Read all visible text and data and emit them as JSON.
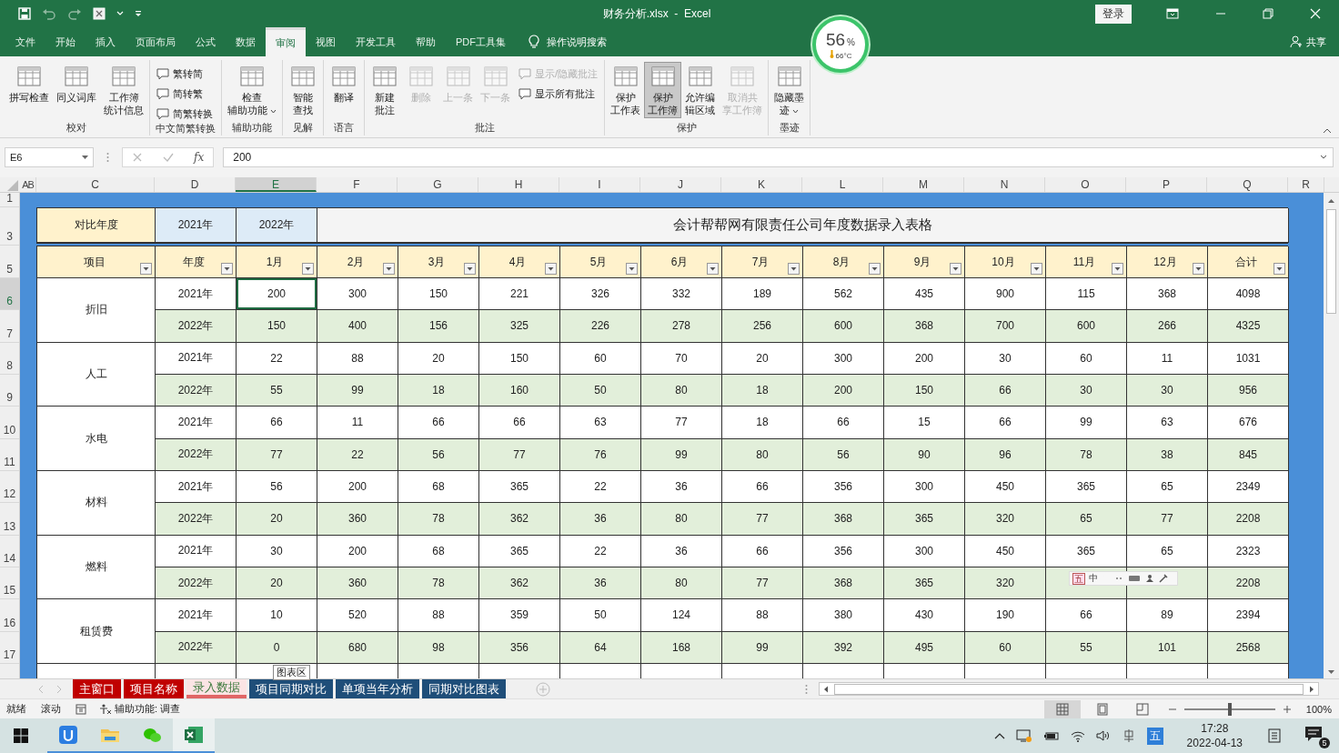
{
  "title_bar": {
    "title": "财务分析.xlsx  -  Excel",
    "sign_in": "登录"
  },
  "ribbon_tabs": [
    {
      "label": "文件",
      "selected": false
    },
    {
      "label": "开始",
      "selected": false
    },
    {
      "label": "插入",
      "selected": false
    },
    {
      "label": "页面布局",
      "selected": false
    },
    {
      "label": "公式",
      "selected": false
    },
    {
      "label": "数据",
      "selected": false
    },
    {
      "label": "审阅",
      "selected": true
    },
    {
      "label": "视图",
      "selected": false
    },
    {
      "label": "开发工具",
      "selected": false
    },
    {
      "label": "帮助",
      "selected": false
    },
    {
      "label": "PDF工具集",
      "selected": false
    }
  ],
  "search": "操作说明搜索",
  "share": "共享",
  "ribbon_groups": [
    {
      "label": "校对",
      "buttons": [
        {
          "label": "拼写检查",
          "kind": "large",
          "disabled": false,
          "selected": false
        },
        {
          "label": "同义词库",
          "kind": "large",
          "disabled": false,
          "selected": false
        },
        {
          "label": [
            "工作簿",
            "统计信息"
          ],
          "kind": "large",
          "disabled": false,
          "selected": false
        }
      ]
    },
    {
      "label": "中文简繁转换",
      "buttons": [
        {
          "label": "繁转简",
          "kind": "small",
          "disabled": false,
          "selected": false
        },
        {
          "label": "简转繁",
          "kind": "small",
          "disabled": false,
          "selected": false
        },
        {
          "label": "简繁转换",
          "kind": "small",
          "disabled": false,
          "selected": false
        }
      ]
    },
    {
      "label": "辅助功能",
      "buttons": [
        {
          "label": [
            "检查",
            "辅助功能"
          ],
          "kind": "large-menu",
          "disabled": false,
          "selected": false
        }
      ]
    },
    {
      "label": "见解",
      "buttons": [
        {
          "label": [
            "智能",
            "查找"
          ],
          "kind": "large",
          "disabled": false,
          "selected": false
        }
      ]
    },
    {
      "label": "语言",
      "buttons": [
        {
          "label": "翻译",
          "kind": "large",
          "disabled": false,
          "selected": false
        }
      ]
    },
    {
      "label": "批注",
      "buttons": [
        {
          "label": [
            "新建",
            "批注"
          ],
          "kind": "large",
          "disabled": false,
          "selected": false
        },
        {
          "label": "删除",
          "kind": "large",
          "disabled": true,
          "selected": false
        },
        {
          "label": "上一条",
          "kind": "large",
          "disabled": true,
          "selected": false
        },
        {
          "label": "下一条",
          "kind": "large",
          "disabled": true,
          "selected": false
        },
        {
          "label": "显示/隐藏批注",
          "kind": "small",
          "disabled": true,
          "selected": false
        },
        {
          "label": "显示所有批注",
          "kind": "small",
          "disabled": false,
          "selected": false
        }
      ]
    },
    {
      "label": "保护",
      "buttons": [
        {
          "label": [
            "保护",
            "工作表"
          ],
          "kind": "large",
          "disabled": false,
          "selected": false
        },
        {
          "label": [
            "保护",
            "工作簿"
          ],
          "kind": "large",
          "disabled": false,
          "selected": true
        },
        {
          "label": [
            "允许编",
            "辑区域"
          ],
          "kind": "large",
          "disabled": false,
          "selected": false
        },
        {
          "label": [
            "取消共",
            "享工作簿"
          ],
          "kind": "large",
          "disabled": true,
          "selected": false
        }
      ]
    },
    {
      "label": "墨迹",
      "buttons": [
        {
          "label": [
            "隐藏墨",
            "迹"
          ],
          "kind": "large-menu",
          "disabled": false,
          "selected": false
        }
      ]
    }
  ],
  "formula_bar": {
    "name_box": "E6",
    "fx": "fx",
    "value": "200"
  },
  "column_headers": [
    {
      "label": "AB",
      "selected": false
    },
    {
      "label": "C",
      "selected": false
    },
    {
      "label": "D",
      "selected": false
    },
    {
      "label": "E",
      "selected": true
    },
    {
      "label": "F",
      "selected": false
    },
    {
      "label": "G",
      "selected": false
    },
    {
      "label": "H",
      "selected": false
    },
    {
      "label": "I",
      "selected": false
    },
    {
      "label": "J",
      "selected": false
    },
    {
      "label": "K",
      "selected": false
    },
    {
      "label": "L",
      "selected": false
    },
    {
      "label": "M",
      "selected": false
    },
    {
      "label": "N",
      "selected": false
    },
    {
      "label": "O",
      "selected": false
    },
    {
      "label": "P",
      "selected": false
    },
    {
      "label": "Q",
      "selected": false
    },
    {
      "label": "R",
      "selected": false
    }
  ],
  "row_headers": [
    {
      "label": "1",
      "selected": false
    },
    {
      "label": "3",
      "selected": false
    },
    {
      "label": "5",
      "selected": false
    },
    {
      "label": "6",
      "selected": true
    },
    {
      "label": "7",
      "selected": false
    },
    {
      "label": "8",
      "selected": false
    },
    {
      "label": "9",
      "selected": false
    },
    {
      "label": "10",
      "selected": false
    },
    {
      "label": "11",
      "selected": false
    },
    {
      "label": "12",
      "selected": false
    },
    {
      "label": "13",
      "selected": false
    },
    {
      "label": "14",
      "selected": false
    },
    {
      "label": "15",
      "selected": false
    },
    {
      "label": "16",
      "selected": false
    },
    {
      "label": "17",
      "selected": false
    }
  ],
  "sheet": {
    "compare_label": "对比年度",
    "years": [
      "2021年",
      "2022年"
    ],
    "title": "会计帮帮网有限责任公司年度数据录入表格",
    "columns": [
      "项目",
      "年度",
      "1月",
      "2月",
      "3月",
      "4月",
      "5月",
      "6月",
      "7月",
      "8月",
      "9月",
      "10月",
      "11月",
      "12月",
      "合计"
    ],
    "groups": [
      {
        "item": "折旧",
        "rows": [
          {
            "year": "2021年",
            "values": [
              "200",
              "300",
              "150",
              "221",
              "326",
              "332",
              "189",
              "562",
              "435",
              "900",
              "115",
              "368"
            ],
            "total": "4098"
          },
          {
            "year": "2022年",
            "values": [
              "150",
              "400",
              "156",
              "325",
              "226",
              "278",
              "256",
              "600",
              "368",
              "700",
              "600",
              "266"
            ],
            "total": "4325"
          }
        ]
      },
      {
        "item": "人工",
        "rows": [
          {
            "year": "2021年",
            "values": [
              "22",
              "88",
              "20",
              "150",
              "60",
              "70",
              "20",
              "300",
              "200",
              "30",
              "60",
              "11"
            ],
            "total": "1031"
          },
          {
            "year": "2022年",
            "values": [
              "55",
              "99",
              "18",
              "160",
              "50",
              "80",
              "18",
              "200",
              "150",
              "66",
              "30",
              "30"
            ],
            "total": "956"
          }
        ]
      },
      {
        "item": "水电",
        "rows": [
          {
            "year": "2021年",
            "values": [
              "66",
              "11",
              "66",
              "66",
              "63",
              "77",
              "18",
              "66",
              "15",
              "66",
              "99",
              "63"
            ],
            "total": "676"
          },
          {
            "year": "2022年",
            "values": [
              "77",
              "22",
              "56",
              "77",
              "76",
              "99",
              "80",
              "56",
              "90",
              "96",
              "78",
              "38"
            ],
            "total": "845"
          }
        ]
      },
      {
        "item": "材料",
        "rows": [
          {
            "year": "2021年",
            "values": [
              "56",
              "200",
              "68",
              "365",
              "22",
              "36",
              "66",
              "356",
              "300",
              "450",
              "365",
              "65"
            ],
            "total": "2349"
          },
          {
            "year": "2022年",
            "values": [
              "20",
              "360",
              "78",
              "362",
              "36",
              "80",
              "77",
              "368",
              "365",
              "320",
              "65",
              "77"
            ],
            "total": "2208"
          }
        ]
      },
      {
        "item": "燃料",
        "rows": [
          {
            "year": "2021年",
            "values": [
              "30",
              "200",
              "68",
              "365",
              "22",
              "36",
              "66",
              "356",
              "300",
              "450",
              "365",
              "65"
            ],
            "total": "2323"
          },
          {
            "year": "2022年",
            "values": [
              "20",
              "360",
              "78",
              "362",
              "36",
              "80",
              "77",
              "368",
              "365",
              "320"
            ],
            "total": "2208"
          }
        ]
      },
      {
        "item": "租赁费",
        "rows": [
          {
            "year": "2021年",
            "values": [
              "10",
              "520",
              "88",
              "359",
              "50",
              "124",
              "88",
              "380",
              "430",
              "190",
              "66",
              "89"
            ],
            "total": "2394"
          },
          {
            "year": "2022年",
            "values": [
              "0",
              "680",
              "98",
              "356",
              "64",
              "168",
              "99",
              "392",
              "495",
              "60",
              "55",
              "101"
            ],
            "total": "2568"
          }
        ]
      }
    ]
  },
  "ime_toolbar": {
    "mode": "五",
    "language": "中"
  },
  "tooltip": "图表区",
  "sheet_tabs": [
    {
      "label": "主窗口",
      "color": "#c00000",
      "selected": false
    },
    {
      "label": "项目名称",
      "color": "#c00000",
      "selected": false
    },
    {
      "label": "录入数据",
      "color": "#e06666",
      "selected": true
    },
    {
      "label": "项目同期对比",
      "color": "#1f4e79",
      "selected": false
    },
    {
      "label": "单项当年分析",
      "color": "#1f4e79",
      "selected": false
    },
    {
      "label": "同期对比图表",
      "color": "#1f4e79",
      "selected": false
    }
  ],
  "status_bar": {
    "ready": "就绪",
    "scroll": "滚动",
    "accessibility": "辅助功能: 调查",
    "zoom": {
      "level": 0.5,
      "label": "100%"
    }
  },
  "widget": {
    "percent": "56",
    "unit": "%",
    "temperature": "66°C"
  },
  "taskbar": {
    "apps": [
      {
        "selected": false
      },
      {
        "selected": false
      },
      {
        "selected": false
      },
      {
        "selected": true
      }
    ],
    "ime": "五",
    "time": "17:28",
    "date": "2022-04-13",
    "badge": "5"
  }
}
